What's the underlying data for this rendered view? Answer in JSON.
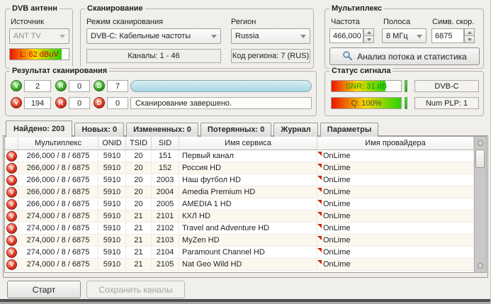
{
  "groups": {
    "antenna": {
      "title": "DVB антенн",
      "source_label": "Источник",
      "source_value": "ANT TV",
      "level_text": "L: 62 dBuV"
    },
    "scan": {
      "title": "Сканирование",
      "mode_label": "Режим сканирования",
      "mode_value": "DVB-C: Кабельные частоты",
      "region_label": "Регион",
      "region_value": "Russia",
      "channels_info": "Каналы: 1 - 46",
      "region_code_info": "Код региона: 7 (RUS)"
    },
    "mux": {
      "title": "Мультиплекс",
      "freq_label": "Частота",
      "freq_value": "466,000",
      "bandwidth_label": "Полоса",
      "bandwidth_value": "8 МГц",
      "symbolrate_label": "Симв. скор.",
      "symbolrate_value": "6875",
      "analyze_button": "Анализ потока и статистика"
    },
    "result": {
      "title": "Результат сканирования",
      "icons": {
        "v": "V",
        "r": "R",
        "d": "D"
      },
      "row1": {
        "v": "2",
        "r": "0",
        "d": "7"
      },
      "row2": {
        "v": "194",
        "r": "0",
        "d": "0"
      },
      "status_text": "Сканирование завершено."
    },
    "signal": {
      "title": "Статус сигнала",
      "snr_text": "SNR: 31 dB",
      "quality_text": "Q: 100%",
      "standard": "DVB-C",
      "num_plp": "Num PLP: 1"
    }
  },
  "tabs": [
    {
      "label": "Найдено: 203",
      "active": true
    },
    {
      "label": "Новых: 0",
      "active": false
    },
    {
      "label": "Измененных: 0",
      "active": false
    },
    {
      "label": "Потерянных: 0",
      "active": false
    },
    {
      "label": "Журнал",
      "active": false
    },
    {
      "label": "Параметры",
      "active": false
    }
  ],
  "table": {
    "columns": [
      "",
      "Мультиплекс",
      "ONID",
      "TSID",
      "SID",
      "Имя сервиса",
      "Имя провайдера"
    ],
    "row_icon": "V",
    "rows": [
      [
        "266,000 / 8 / 6875",
        "5910",
        "20",
        "151",
        "Первый канал",
        "OnLime"
      ],
      [
        "266,000 / 8 / 6875",
        "5910",
        "20",
        "152",
        "Россия HD",
        "OnLime"
      ],
      [
        "266,000 / 8 / 6875",
        "5910",
        "20",
        "2003",
        "Наш футбол HD",
        "OnLime"
      ],
      [
        "266,000 / 8 / 6875",
        "5910",
        "20",
        "2004",
        "Amedia Premium HD",
        "OnLime"
      ],
      [
        "266,000 / 8 / 6875",
        "5910",
        "20",
        "2005",
        "AMEDIA 1 HD",
        "OnLime"
      ],
      [
        "274,000 / 8 / 6875",
        "5910",
        "21",
        "2101",
        "КХЛ HD",
        "OnLime"
      ],
      [
        "274,000 / 8 / 6875",
        "5910",
        "21",
        "2102",
        "Travel and Adventure HD",
        "OnLime"
      ],
      [
        "274,000 / 8 / 6875",
        "5910",
        "21",
        "2103",
        "MyZen HD",
        "OnLime"
      ],
      [
        "274,000 / 8 / 6875",
        "5910",
        "21",
        "2104",
        "Paramount Channel HD",
        "OnLime"
      ],
      [
        "274,000 / 8 / 6875",
        "5910",
        "21",
        "2105",
        "Nat Geo Wild HD",
        "OnLime"
      ]
    ]
  },
  "footer": {
    "start_button": "Старт",
    "save_button": "Сохранить каналы"
  },
  "colors": {
    "level_text": "#d40000",
    "snr_text": "#00a000",
    "quality_text": "#4a4a38",
    "gradient_low": "#ec1500",
    "gradient_mid": "#f8d800",
    "gradient_high": "#27d400",
    "progress_fill": "#a8d6e4"
  }
}
